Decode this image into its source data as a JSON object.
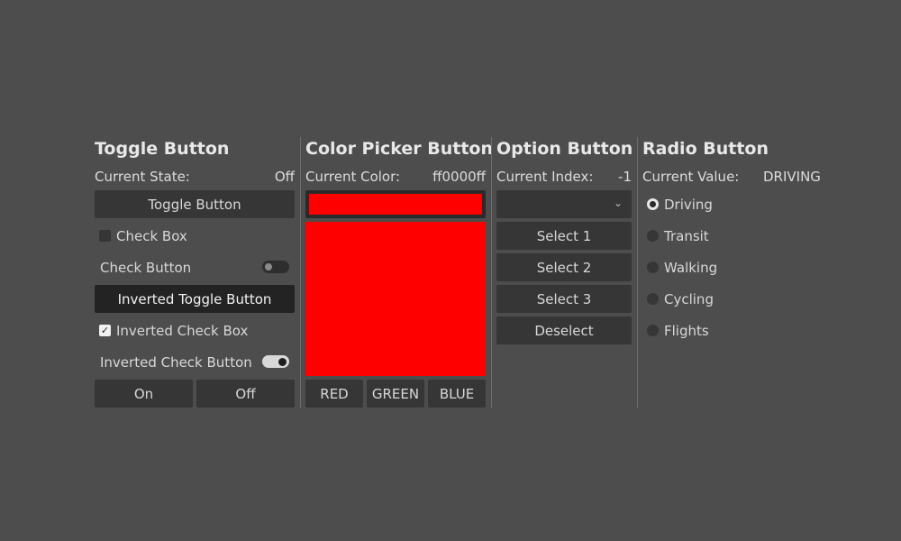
{
  "colors": {
    "background": "#4d4d4d",
    "button": "#363636",
    "pressed": "#232323",
    "picked_color": "#ff0000"
  },
  "toggle_section": {
    "title": "Toggle Button",
    "state_label": "Current State:",
    "state_value": "Off",
    "toggle_button": "Toggle Button",
    "check_box": "Check Box",
    "check_button": "Check Button",
    "inverted_toggle_button": "Inverted Toggle Button",
    "inverted_check_box": "Inverted Check Box",
    "inverted_check_button": "Inverted Check Button",
    "on_button": "On",
    "off_button": "Off"
  },
  "color_section": {
    "title": "Color Picker Button",
    "color_label": "Current Color:",
    "color_value": "ff0000ff",
    "buttons": [
      "RED",
      "GREEN",
      "BLUE"
    ]
  },
  "option_section": {
    "title": "Option Button",
    "index_label": "Current Index:",
    "index_value": "-1",
    "dropdown_value": "",
    "buttons": [
      "Select 1",
      "Select 2",
      "Select 3",
      "Deselect"
    ]
  },
  "radio_section": {
    "title": "Radio Button",
    "value_label": "Current Value:",
    "value": "DRIVING",
    "options": [
      "Driving",
      "Transit",
      "Walking",
      "Cycling",
      "Flights"
    ],
    "selected_index": 0
  }
}
